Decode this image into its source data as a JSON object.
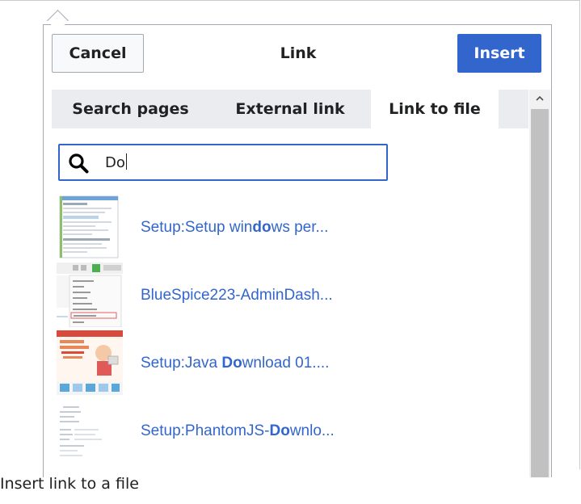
{
  "dialog": {
    "title": "Link",
    "cancel_label": "Cancel",
    "insert_label": "Insert"
  },
  "tabs": [
    {
      "label": "Search pages",
      "active": false
    },
    {
      "label": "External link",
      "active": false
    },
    {
      "label": "Link to file",
      "active": true
    }
  ],
  "search": {
    "value": "Do",
    "icon": "search-icon"
  },
  "results": [
    {
      "pre": "Setup:Setup win",
      "match": "do",
      "post": "ws per..."
    },
    {
      "pre": "BlueSpice223-AdminDash...",
      "match": "",
      "post": ""
    },
    {
      "pre": "Setup:Java ",
      "match": "Do",
      "post": "wnload 01...."
    },
    {
      "pre": "Setup:PhantomJS-",
      "match": "Do",
      "post": "wnlo..."
    }
  ],
  "caption": "Insert link to a file",
  "colors": {
    "accent": "#3366cc",
    "tab_bar": "#eaecf0",
    "border": "#a2a9b1"
  }
}
